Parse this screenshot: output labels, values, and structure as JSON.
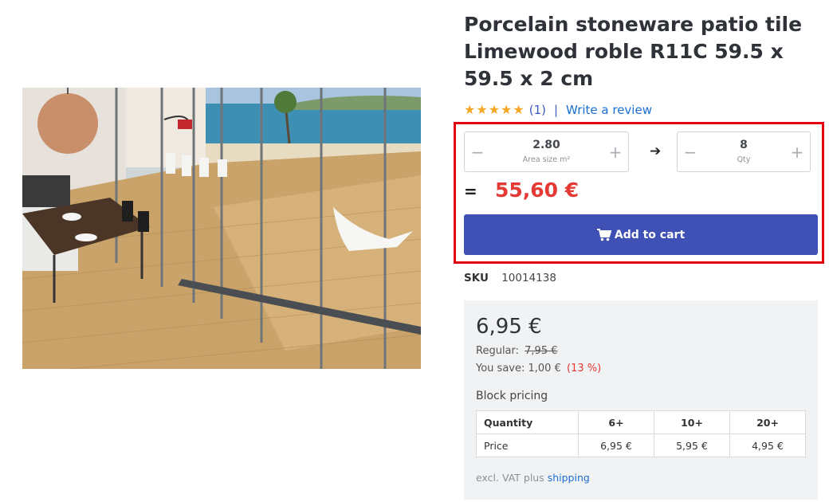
{
  "product": {
    "title": "Porcelain stoneware patio tile Limewood roble R11C 59.5 x 59.5 x 2 cm",
    "rating_count": "(1)",
    "separator": "|",
    "write_review": "Write a review",
    "stars": 5
  },
  "calculator": {
    "area_value": "2.80",
    "area_label": "Area size m²",
    "qty_value": "8",
    "qty_label": "Qty",
    "minus": "−",
    "plus": "+",
    "arrow": "➔",
    "equals": "=",
    "total": "55,60 €"
  },
  "cart": {
    "label": "Add to cart",
    "icon": "cart-icon"
  },
  "sku": {
    "label": "SKU",
    "value": "10014138"
  },
  "pricing": {
    "price": "6,95 €",
    "regular_label": "Regular:",
    "regular_value": "7,95 €",
    "save_label": "You save:",
    "save_value": "1,00 €",
    "save_pct": "(13 %)",
    "block_title": "Block pricing",
    "block_table": {
      "header": [
        "Quantity",
        "6+",
        "10+",
        "20+"
      ],
      "row": [
        "Price",
        "6,95 €",
        "5,95 €",
        "4,95 €"
      ]
    },
    "vat_text": "excl. VAT plus",
    "shipping_link": "shipping"
  },
  "colors": {
    "accent": "#3f51b5",
    "price_red": "#e53935",
    "highlight": "#e3000f",
    "star": "#f5a623"
  }
}
